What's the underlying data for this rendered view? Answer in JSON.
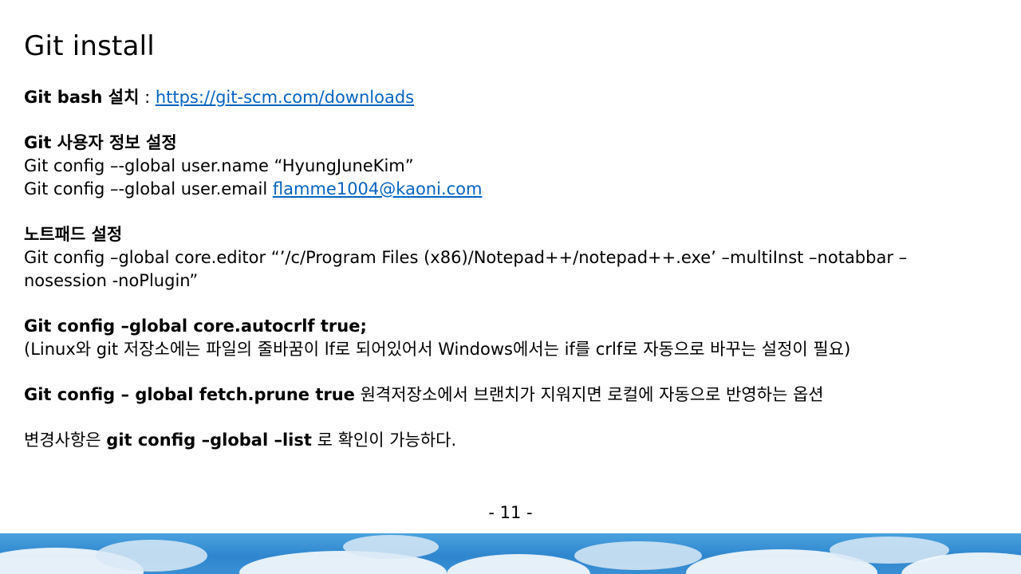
{
  "slide": {
    "title": "Git install",
    "bash_label": "Git bash 설치",
    "bash_sep": " : ",
    "bash_url": "https://git-scm.com/downloads",
    "user_heading": "Git 사용자 정보 설정",
    "user_name_cmd": "Git config –-global  user.name  “HyungJuneKim”",
    "user_email_cmd_prefix": "Git config –-global  user.email  ",
    "user_email": "flamme1004@kaoni.com",
    "notepad_heading": "노트패드 설정",
    "notepad_cmd": "Git config –global  core.editor  “’/c/Program Files (x86)/Notepad++/notepad++.exe’ –multiInst –notabbar –nosession -noPlugin”",
    "autocrlf_cmd": "Git config –global core.autocrlf true;",
    "autocrlf_desc": "(Linux와 git 저장소에는 파일의 줄바꿈이 lf로 되어있어서 Windows에서는 if를 crlf로 자동으로 바꾸는 설정이 필요)",
    "prune_cmd": "Git config – global fetch.prune true",
    "prune_desc": " 원격저장소에서 브랜치가 지워지면 로컬에 자동으로 반영하는 옵션",
    "check_prefix": "변경사항은 ",
    "check_cmd": "git config –global –list",
    "check_suffix": " 로 확인이 가능하다.",
    "page_number": "- 11 -"
  },
  "colors": {
    "link": "#0563c1",
    "text": "#000000",
    "sky": "#2f86cf"
  }
}
